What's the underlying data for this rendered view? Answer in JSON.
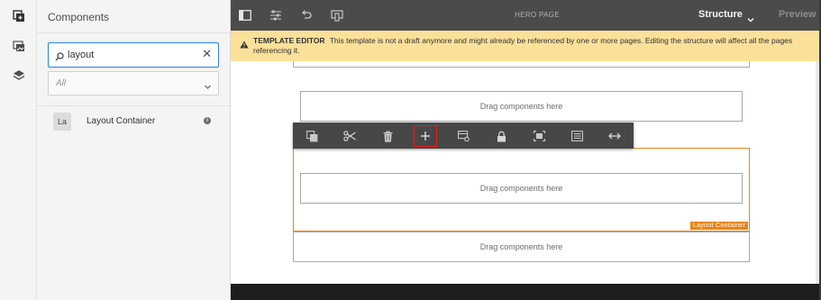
{
  "panel": {
    "title": "Components",
    "search": {
      "value": "layout",
      "placeholder": "",
      "clear_glyph": "✕"
    },
    "filter": {
      "selected": "All"
    },
    "components": [
      {
        "abbr": "La",
        "name": "Layout Container",
        "info_glyph": "i"
      }
    ]
  },
  "rail": {
    "icons": [
      "components-icon",
      "assets-icon",
      "layers-icon"
    ]
  },
  "topbar": {
    "icons": [
      "toggle-side-panel-icon",
      "page-information-icon",
      "undo-icon",
      "emulator-icon"
    ],
    "page_name": "HERO PAGE",
    "mode_label": "Structure",
    "preview_label": "Preview"
  },
  "banner": {
    "heading": "TEMPLATE EDITOR",
    "text": "This template is not a draft anymore and might already be referenced by one or more pages. Editing the structure will affect all the pages referencing it."
  },
  "canvas": {
    "drop_label": "Drag components here",
    "selected_tag": "Layout Container"
  },
  "floating_toolbar": {
    "actions": [
      "parent-icon",
      "cut-icon",
      "delete-icon",
      "insert-component-icon",
      "policy-icon",
      "lock-icon",
      "layout-icon",
      "properties-icon",
      "resize-icon"
    ],
    "highlighted": "insert-component-icon"
  },
  "colors": {
    "accent": "#2680eb",
    "toolbar": "#4b4b4b",
    "banner": "#fbe09a",
    "selection": "#e68619",
    "highlight": "#e31d1d"
  }
}
